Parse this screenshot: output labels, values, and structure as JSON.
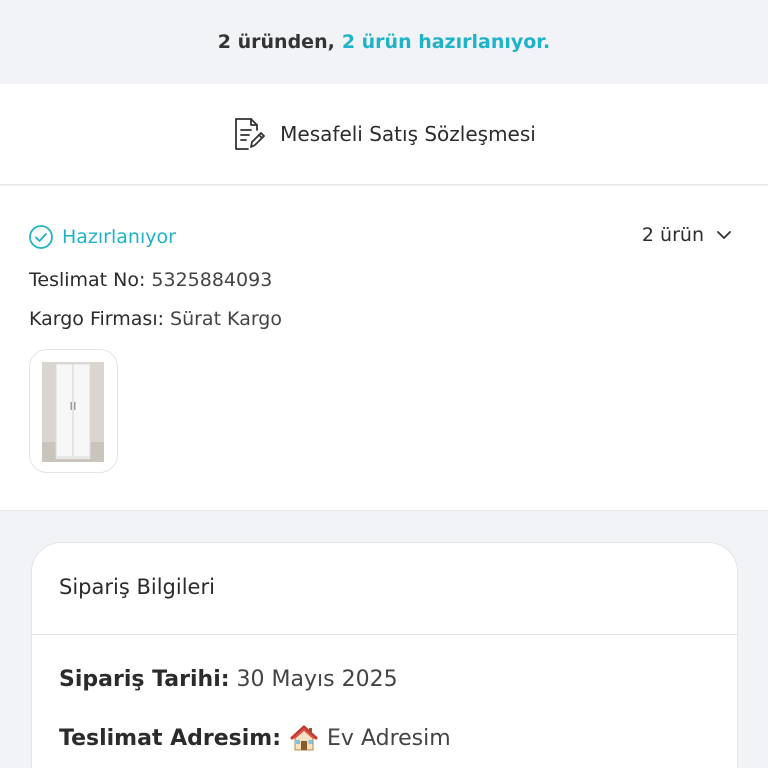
{
  "banner": {
    "prefix": "2 üründen,",
    "highlight": "2 ürün hazırlanıyor."
  },
  "contract": {
    "label": "Mesafeli Satış Sözleşmesi",
    "icon": "contract-edit-icon"
  },
  "delivery": {
    "status": "Hazırlanıyor",
    "status_icon": "check-circle-icon",
    "item_count": "2 ürün",
    "delivery_no_label": "Teslimat No:",
    "delivery_no_value": "5325884093",
    "carrier_label": "Kargo Firması:",
    "carrier_value": "Sürat Kargo",
    "thumbnail": "white-wardrobe-product-image"
  },
  "order_info": {
    "title": "Sipariş Bilgileri",
    "date_label": "Sipariş Tarihi:",
    "date_value": "30 Mayıs 2025",
    "address_label": "Teslimat Adresim:",
    "address_icon": "house-emoji-icon",
    "address_value": "Ev Adresim"
  },
  "colors": {
    "accent": "#1fb3c9",
    "background": "#f1f3f6",
    "text": "#2b2b2b"
  }
}
